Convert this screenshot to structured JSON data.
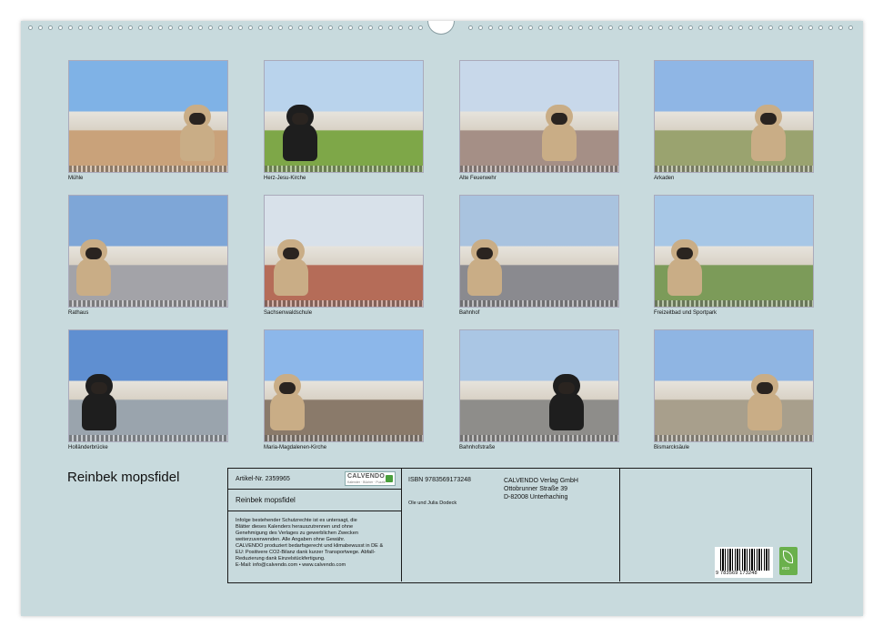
{
  "calendar_title": "Reinbek mopsfidel",
  "photos": [
    {
      "caption": "Mühle",
      "sky": "#7fb2e6",
      "ground": "#c9a27a"
    },
    {
      "caption": "Herz-Jesu-Kirche",
      "sky": "#b9d3ec",
      "ground": "#7ea748"
    },
    {
      "caption": "Alte Feuerwehr",
      "sky": "#c8d8ea",
      "ground": "#a58f86"
    },
    {
      "caption": "Arkaden",
      "sky": "#8fb6e5",
      "ground": "#9aa36f"
    },
    {
      "caption": "Rathaus",
      "sky": "#7ea6d7",
      "ground": "#a3a3a8"
    },
    {
      "caption": "Sachsenwaldschule",
      "sky": "#d8e1ea",
      "ground": "#b56c58"
    },
    {
      "caption": "Bahnhof",
      "sky": "#a9c3df",
      "ground": "#8a8a8f"
    },
    {
      "caption": "Freizeitbad und Sportpark",
      "sky": "#a7c7e6",
      "ground": "#7c9b59"
    },
    {
      "caption": "Holländerbrücke",
      "sky": "#5f8fd1",
      "ground": "#9aa4ad"
    },
    {
      "caption": "Maria-Magdalenen-Kirche",
      "sky": "#8cb7ea",
      "ground": "#8a7a6a"
    },
    {
      "caption": "Bahnhofstraße",
      "sky": "#aac6e4",
      "ground": "#8e8d8a"
    },
    {
      "caption": "Bismarcksäule",
      "sky": "#8fb5e3",
      "ground": "#a89f8c"
    }
  ],
  "info": {
    "article": "Artikel-Nr. 2359965",
    "logo_text": "CALVENDO",
    "logo_sub": "Kalender · Bücher · Puzzle",
    "title": "Reinbek mopsfidel",
    "legal": [
      "Infolge bestehender Schutzrechte ist es untersagt, die",
      "Blätter dieses Kalenders herauszutrennen und ohne",
      "Genehmigung des Verlages zu gewerblichen Zwecken",
      "weiterzuverwenden. Alle Angaben ohne Gewähr.",
      "CALVENDO produziert bedarfsgerecht und klimabewusst in DE &",
      "EU: Positivere CO2-Bilanz dank kurzer Transportwege. Abfall-",
      "Reduzierung dank Einzelstückfertigung.",
      "E-Mail: info@calvendo.com • www.calvendo.com"
    ],
    "isbn": "ISBN 9783569173248",
    "publisher_name": "CALVENDO Verlag GmbH",
    "publisher_street": "Ottobrunner Straße 39",
    "publisher_city": "D-82008 Unterhaching",
    "authors": "Ole und Julia Dodeck",
    "barcode_number": "9 783569 173248",
    "eco_label": "eco"
  }
}
